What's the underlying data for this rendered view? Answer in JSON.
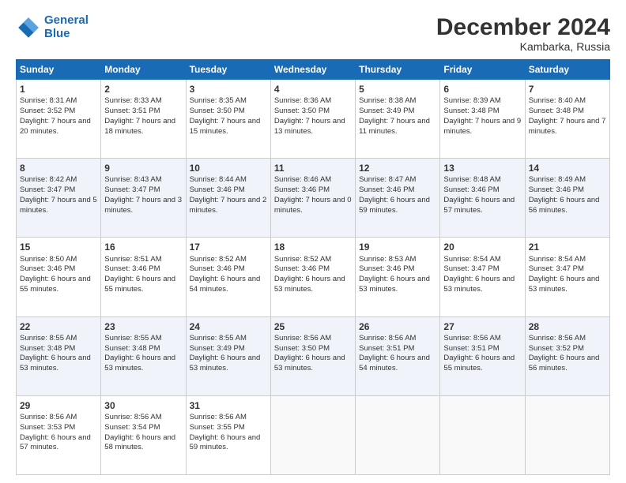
{
  "header": {
    "logo_line1": "General",
    "logo_line2": "Blue",
    "month": "December 2024",
    "location": "Kambarka, Russia"
  },
  "weekdays": [
    "Sunday",
    "Monday",
    "Tuesday",
    "Wednesday",
    "Thursday",
    "Friday",
    "Saturday"
  ],
  "weeks": [
    [
      {
        "day": "1",
        "rise": "Sunrise: 8:31 AM",
        "set": "Sunset: 3:52 PM",
        "daylight": "Daylight: 7 hours and 20 minutes."
      },
      {
        "day": "2",
        "rise": "Sunrise: 8:33 AM",
        "set": "Sunset: 3:51 PM",
        "daylight": "Daylight: 7 hours and 18 minutes."
      },
      {
        "day": "3",
        "rise": "Sunrise: 8:35 AM",
        "set": "Sunset: 3:50 PM",
        "daylight": "Daylight: 7 hours and 15 minutes."
      },
      {
        "day": "4",
        "rise": "Sunrise: 8:36 AM",
        "set": "Sunset: 3:50 PM",
        "daylight": "Daylight: 7 hours and 13 minutes."
      },
      {
        "day": "5",
        "rise": "Sunrise: 8:38 AM",
        "set": "Sunset: 3:49 PM",
        "daylight": "Daylight: 7 hours and 11 minutes."
      },
      {
        "day": "6",
        "rise": "Sunrise: 8:39 AM",
        "set": "Sunset: 3:48 PM",
        "daylight": "Daylight: 7 hours and 9 minutes."
      },
      {
        "day": "7",
        "rise": "Sunrise: 8:40 AM",
        "set": "Sunset: 3:48 PM",
        "daylight": "Daylight: 7 hours and 7 minutes."
      }
    ],
    [
      {
        "day": "8",
        "rise": "Sunrise: 8:42 AM",
        "set": "Sunset: 3:47 PM",
        "daylight": "Daylight: 7 hours and 5 minutes."
      },
      {
        "day": "9",
        "rise": "Sunrise: 8:43 AM",
        "set": "Sunset: 3:47 PM",
        "daylight": "Daylight: 7 hours and 3 minutes."
      },
      {
        "day": "10",
        "rise": "Sunrise: 8:44 AM",
        "set": "Sunset: 3:46 PM",
        "daylight": "Daylight: 7 hours and 2 minutes."
      },
      {
        "day": "11",
        "rise": "Sunrise: 8:46 AM",
        "set": "Sunset: 3:46 PM",
        "daylight": "Daylight: 7 hours and 0 minutes."
      },
      {
        "day": "12",
        "rise": "Sunrise: 8:47 AM",
        "set": "Sunset: 3:46 PM",
        "daylight": "Daylight: 6 hours and 59 minutes."
      },
      {
        "day": "13",
        "rise": "Sunrise: 8:48 AM",
        "set": "Sunset: 3:46 PM",
        "daylight": "Daylight: 6 hours and 57 minutes."
      },
      {
        "day": "14",
        "rise": "Sunrise: 8:49 AM",
        "set": "Sunset: 3:46 PM",
        "daylight": "Daylight: 6 hours and 56 minutes."
      }
    ],
    [
      {
        "day": "15",
        "rise": "Sunrise: 8:50 AM",
        "set": "Sunset: 3:46 PM",
        "daylight": "Daylight: 6 hours and 55 minutes."
      },
      {
        "day": "16",
        "rise": "Sunrise: 8:51 AM",
        "set": "Sunset: 3:46 PM",
        "daylight": "Daylight: 6 hours and 55 minutes."
      },
      {
        "day": "17",
        "rise": "Sunrise: 8:52 AM",
        "set": "Sunset: 3:46 PM",
        "daylight": "Daylight: 6 hours and 54 minutes."
      },
      {
        "day": "18",
        "rise": "Sunrise: 8:52 AM",
        "set": "Sunset: 3:46 PM",
        "daylight": "Daylight: 6 hours and 53 minutes."
      },
      {
        "day": "19",
        "rise": "Sunrise: 8:53 AM",
        "set": "Sunset: 3:46 PM",
        "daylight": "Daylight: 6 hours and 53 minutes."
      },
      {
        "day": "20",
        "rise": "Sunrise: 8:54 AM",
        "set": "Sunset: 3:47 PM",
        "daylight": "Daylight: 6 hours and 53 minutes."
      },
      {
        "day": "21",
        "rise": "Sunrise: 8:54 AM",
        "set": "Sunset: 3:47 PM",
        "daylight": "Daylight: 6 hours and 53 minutes."
      }
    ],
    [
      {
        "day": "22",
        "rise": "Sunrise: 8:55 AM",
        "set": "Sunset: 3:48 PM",
        "daylight": "Daylight: 6 hours and 53 minutes."
      },
      {
        "day": "23",
        "rise": "Sunrise: 8:55 AM",
        "set": "Sunset: 3:48 PM",
        "daylight": "Daylight: 6 hours and 53 minutes."
      },
      {
        "day": "24",
        "rise": "Sunrise: 8:55 AM",
        "set": "Sunset: 3:49 PM",
        "daylight": "Daylight: 6 hours and 53 minutes."
      },
      {
        "day": "25",
        "rise": "Sunrise: 8:56 AM",
        "set": "Sunset: 3:50 PM",
        "daylight": "Daylight: 6 hours and 53 minutes."
      },
      {
        "day": "26",
        "rise": "Sunrise: 8:56 AM",
        "set": "Sunset: 3:51 PM",
        "daylight": "Daylight: 6 hours and 54 minutes."
      },
      {
        "day": "27",
        "rise": "Sunrise: 8:56 AM",
        "set": "Sunset: 3:51 PM",
        "daylight": "Daylight: 6 hours and 55 minutes."
      },
      {
        "day": "28",
        "rise": "Sunrise: 8:56 AM",
        "set": "Sunset: 3:52 PM",
        "daylight": "Daylight: 6 hours and 56 minutes."
      }
    ],
    [
      {
        "day": "29",
        "rise": "Sunrise: 8:56 AM",
        "set": "Sunset: 3:53 PM",
        "daylight": "Daylight: 6 hours and 57 minutes."
      },
      {
        "day": "30",
        "rise": "Sunrise: 8:56 AM",
        "set": "Sunset: 3:54 PM",
        "daylight": "Daylight: 6 hours and 58 minutes."
      },
      {
        "day": "31",
        "rise": "Sunrise: 8:56 AM",
        "set": "Sunset: 3:55 PM",
        "daylight": "Daylight: 6 hours and 59 minutes."
      },
      null,
      null,
      null,
      null
    ]
  ]
}
